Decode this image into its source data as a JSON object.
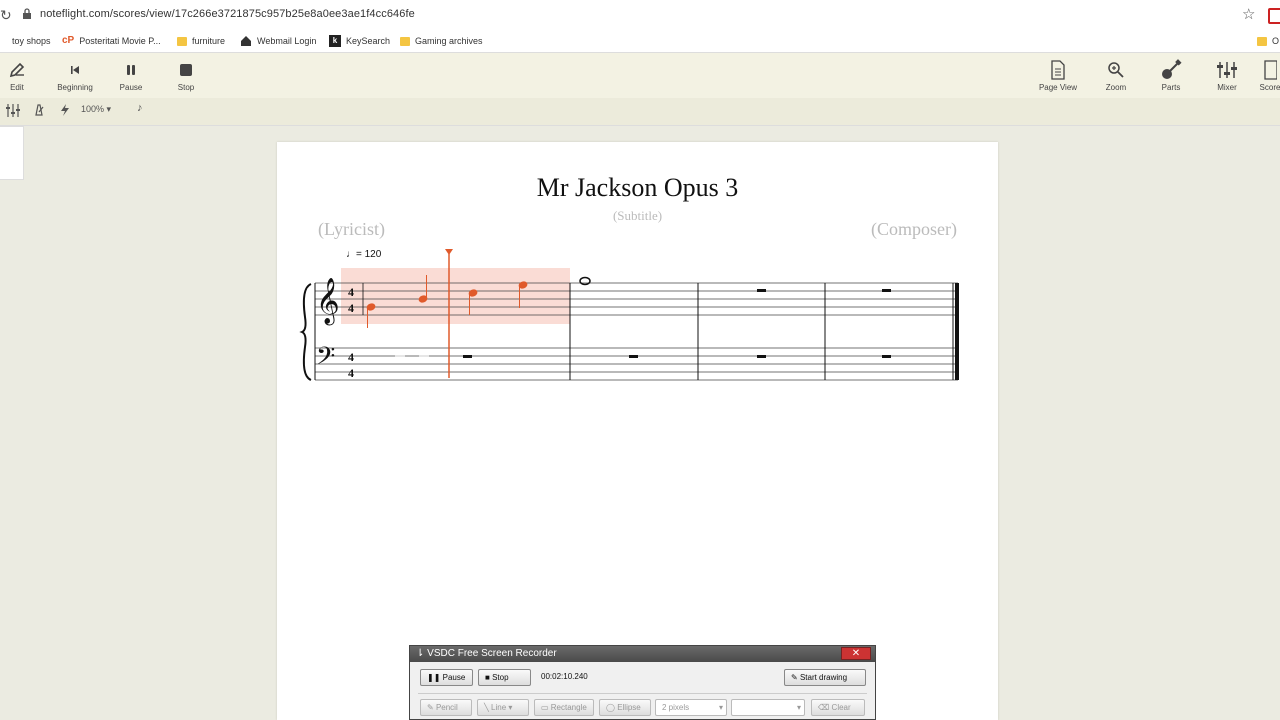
{
  "browser": {
    "url": "noteflight.com/scores/view/17c266e3721875c957b25e8a0ee3ae1f4cc646fe",
    "bookmarks": [
      {
        "label": "toy shops"
      },
      {
        "label": "Posteritati Movie P..."
      },
      {
        "label": "furniture"
      },
      {
        "label": "Webmail Login"
      },
      {
        "label": "KeySearch"
      },
      {
        "label": "Gaming archives"
      },
      {
        "label": "O"
      }
    ]
  },
  "toolbar": {
    "left": [
      {
        "label": "Edit",
        "icon": "pencil-icon"
      },
      {
        "label": "Beginning",
        "icon": "skip-back-icon"
      },
      {
        "label": "Pause",
        "icon": "pause-icon"
      },
      {
        "label": "Stop",
        "icon": "stop-icon"
      }
    ],
    "right": [
      {
        "label": "Page View",
        "icon": "page-icon"
      },
      {
        "label": "Zoom",
        "icon": "zoom-icon"
      },
      {
        "label": "Parts",
        "icon": "guitar-icon"
      },
      {
        "label": "Mixer",
        "icon": "mixer-icon"
      },
      {
        "label": "Score",
        "icon": "score-icon"
      }
    ],
    "zoom": "100%"
  },
  "score": {
    "title": "Mr Jackson Opus 3",
    "subtitle": "(Subtitle)",
    "lyricist": "(Lyricist)",
    "composer": "(Composer)",
    "tempo": "= 120",
    "time_signature": "4/4",
    "highlight_color": "#fadcd5",
    "note_color": "#e05a2b"
  },
  "recorder": {
    "title": "VSDC Free Screen Recorder",
    "pause": "Pause",
    "stop": "Stop",
    "time": "00:02:10.240",
    "start_drawing": "Start drawing",
    "tools": [
      "Pencil",
      "Line",
      "Rectangle",
      "Ellipse",
      "2 pixels",
      "Clear"
    ]
  }
}
